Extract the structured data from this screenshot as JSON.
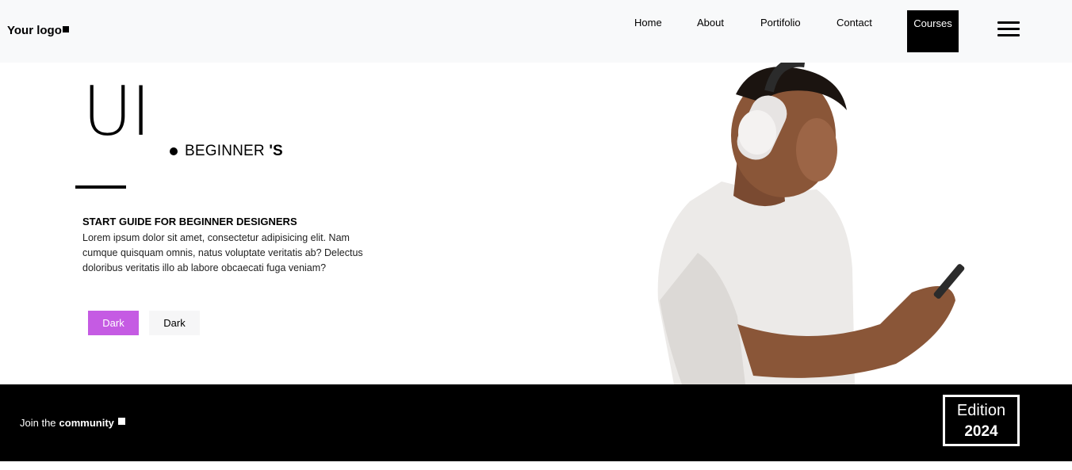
{
  "header": {
    "logo_text": "Your logo",
    "nav": [
      "Home",
      "About",
      "Portifolio",
      "Contact"
    ],
    "courses": "Courses"
  },
  "hero": {
    "title": "UI",
    "subtitle_regular": "BEGINNER ",
    "subtitle_bold": "'S",
    "intro_heading": "START GUIDE FOR BEGINNER DESIGNERS",
    "intro_text": "Lorem ipsum dolor sit amet, consectetur adipisicing elit. Nam cumque quisquam omnis, natus voluptate veritatis ab? Delectus doloribus veritatis illo ab labore obcaecati fuga veniam?",
    "btn_primary": "Dark",
    "btn_secondary": "Dark"
  },
  "footer": {
    "join_prefix": "Join the",
    "join_bold": "community",
    "edition_label": "Edition",
    "edition_year": "2024"
  },
  "colors": {
    "accent": "#c55be3",
    "header_bg": "#f8f9fa",
    "band_bg": "#000000"
  }
}
